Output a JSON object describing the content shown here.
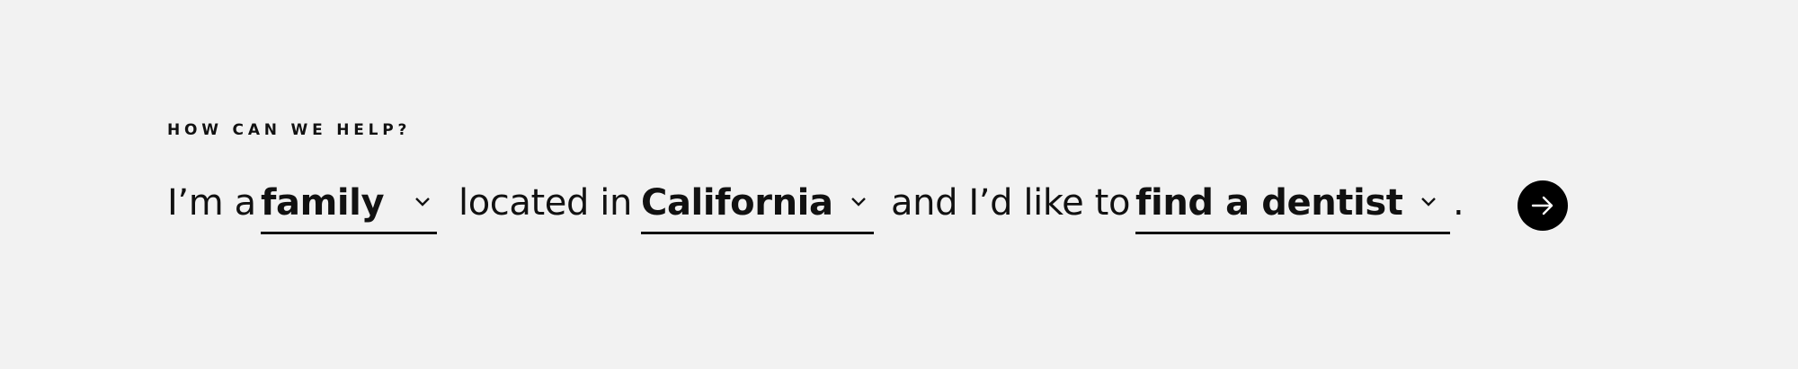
{
  "heading": "HOW CAN WE HELP?",
  "sentence": {
    "prefix": "I’m a",
    "audience": {
      "value": "family"
    },
    "middle1": "located in",
    "location": {
      "value": "California"
    },
    "middle2": "and I’d like to",
    "action": {
      "value": "find a dentist"
    },
    "suffix": "."
  },
  "icons": {
    "dropdown": "chevron-down-icon",
    "submit": "arrow-right-icon"
  },
  "colors": {
    "background": "#f2f2f2",
    "text": "#111111",
    "button": "#000000",
    "button_icon": "#ffffff"
  }
}
